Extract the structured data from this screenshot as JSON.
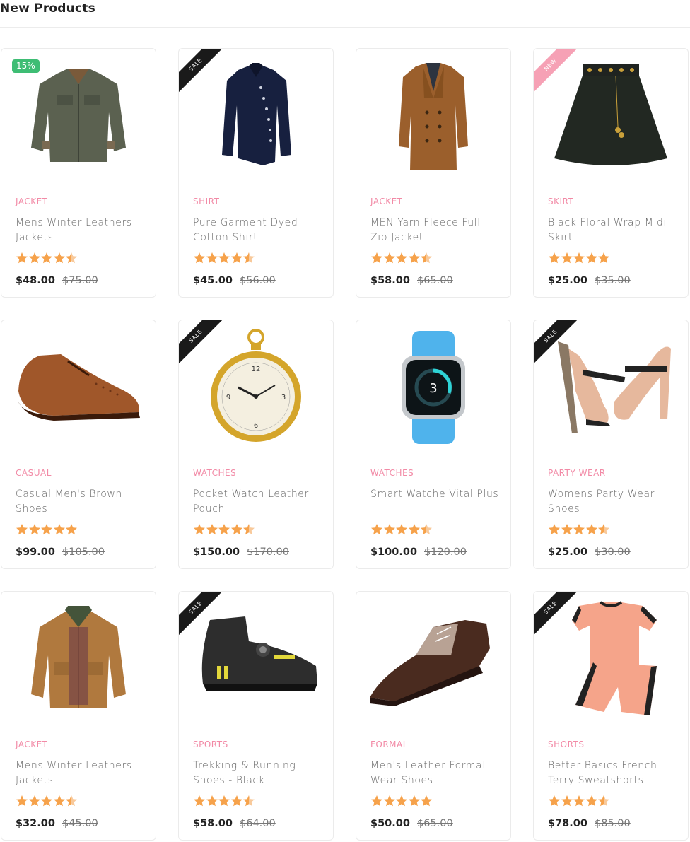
{
  "section": {
    "title": "New Products"
  },
  "products": [
    {
      "badge": "15%",
      "badge_type": "pct",
      "category": "JACKET",
      "title": "Mens Winter Leathers Jackets",
      "rating": 4.5,
      "price": "$48.00",
      "old_price": "$75.00",
      "icon": "jacket-green-icon"
    },
    {
      "badge": "SALE",
      "badge_type": "dark",
      "category": "SHIRT",
      "title": "Pure Garment Dyed Cotton Shirt",
      "rating": 4.5,
      "price": "$45.00",
      "old_price": "$56.00",
      "icon": "shirt-navy-icon"
    },
    {
      "badge": "",
      "badge_type": "none",
      "category": "JACKET",
      "title": "MEN Yarn Fleece Full-Zip Jacket",
      "rating": 4.5,
      "price": "$58.00",
      "old_price": "$65.00",
      "icon": "coat-brown-icon"
    },
    {
      "badge": "NEW",
      "badge_type": "pink",
      "category": "SKIRT",
      "title": "Black Floral Wrap Midi Skirt",
      "rating": 5,
      "price": "$25.00",
      "old_price": "$35.00",
      "icon": "skirt-black-icon"
    },
    {
      "badge": "",
      "badge_type": "none",
      "category": "CASUAL",
      "title": "Casual Men's Brown Shoes",
      "rating": 5,
      "price": "$99.00",
      "old_price": "$105.00",
      "icon": "brown-shoe-icon"
    },
    {
      "badge": "SALE",
      "badge_type": "dark",
      "category": "WATCHES",
      "title": "Pocket Watch Leather Pouch",
      "rating": 4.5,
      "price": "$150.00",
      "old_price": "$170.00",
      "icon": "pocket-watch-icon"
    },
    {
      "badge": "",
      "badge_type": "none",
      "category": "WATCHES",
      "title": "Smart Watche Vital Plus",
      "rating": 4.5,
      "price": "$100.00",
      "old_price": "$120.00",
      "icon": "smart-watch-icon"
    },
    {
      "badge": "SALE",
      "badge_type": "dark",
      "category": "PARTY WEAR",
      "title": "Womens Party Wear Shoes",
      "rating": 4.5,
      "price": "$25.00",
      "old_price": "$30.00",
      "icon": "high-heels-icon"
    },
    {
      "badge": "",
      "badge_type": "none",
      "category": "JACKET",
      "title": "Mens Winter Leathers Jackets",
      "rating": 4.5,
      "price": "$32.00",
      "old_price": "$45.00",
      "icon": "jacket-tan-icon"
    },
    {
      "badge": "SALE",
      "badge_type": "dark",
      "category": "SPORTS",
      "title": "Trekking & Running Shoes - Black",
      "rating": 4.5,
      "price": "$58.00",
      "old_price": "$64.00",
      "icon": "sport-shoe-icon"
    },
    {
      "badge": "",
      "badge_type": "none",
      "category": "FORMAL",
      "title": "Men's Leather Formal Wear Shoes",
      "rating": 5,
      "price": "$50.00",
      "old_price": "$65.00",
      "icon": "formal-shoe-icon"
    },
    {
      "badge": "SALE",
      "badge_type": "dark",
      "category": "SHORTS",
      "title": "Better Basics French Terry Sweatshorts",
      "rating": 4.5,
      "price": "$78.00",
      "old_price": "$85.00",
      "icon": "shorts-set-icon"
    }
  ],
  "colors": {
    "star": "#f6a24b",
    "category": "#f28aa6",
    "pct_badge": "#3ebd74",
    "new_badge": "#f6a1b5",
    "sale_badge": "#1a1a1a"
  }
}
